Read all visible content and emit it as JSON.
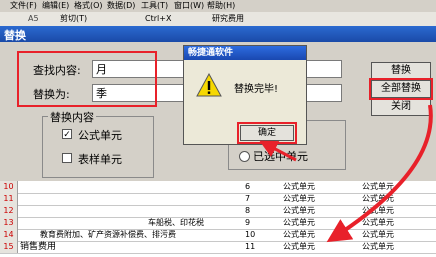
{
  "menu": [
    "文件(F)",
    "编辑(E)",
    "格式(O)",
    "数据(D)",
    "工具(T)",
    "窗口(W)",
    "帮助(H)"
  ],
  "toolbar": {
    "cell_ref": "A5",
    "cut": "剪切(T)",
    "shortcut": "Ctrl+X",
    "formula_value": "研究费用"
  },
  "dialog": {
    "title": "替换",
    "find_label": "查找内容:",
    "find_value": "月",
    "replace_label": "替换为:",
    "replace_value": "季",
    "group_label": "替换内容",
    "option_formula": "公式单元",
    "option_formula_checked": true,
    "option_table": "表样单元",
    "option_table_checked": false,
    "option_selected": "已选中单元",
    "btn_replace": "替换",
    "btn_replace_all": "全部替换",
    "btn_close": "关闭"
  },
  "message": {
    "title": "畅捷通软件",
    "text": "替换完毕!",
    "ok": "确定"
  },
  "sheet": {
    "rows": [
      {
        "num": "10",
        "a": "",
        "b": "",
        "c": "6",
        "d": "公式单元",
        "e": "公式单元"
      },
      {
        "num": "11",
        "a": "",
        "b": "",
        "c": "7",
        "d": "公式单元",
        "e": "公式单元"
      },
      {
        "num": "12",
        "a": "",
        "b": "",
        "c": "8",
        "d": "公式单元",
        "e": "公式单元"
      },
      {
        "num": "13",
        "a": "",
        "b": "车船税、印花税",
        "c": "9",
        "d": "公式单元",
        "e": "公式单元"
      },
      {
        "num": "14",
        "a": "",
        "b": "教育费附加、矿产资源补偿费、排污费",
        "c": "10",
        "d": "公式单元",
        "e": "公式单元"
      },
      {
        "num": "15",
        "a": "销售费用",
        "b": "",
        "c": "11",
        "d": "公式单元",
        "e": "公式单元"
      }
    ]
  },
  "colors": {
    "highlight": "#e8212a",
    "title_blue": "#1a4aa8"
  }
}
